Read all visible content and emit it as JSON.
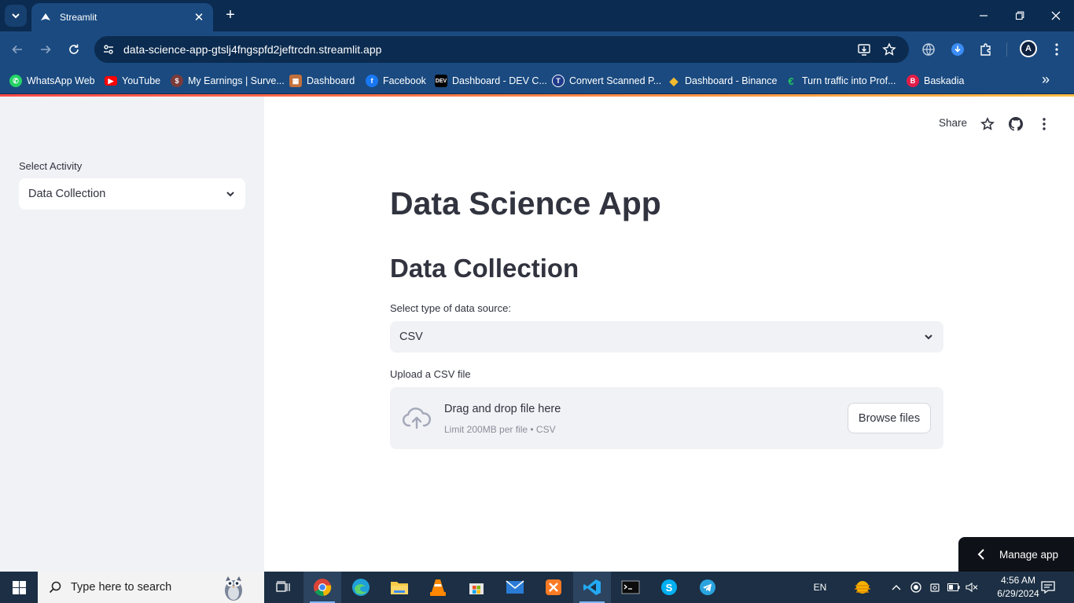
{
  "browser": {
    "tab_title": "Streamlit",
    "url": "data-science-app-gtslj4fngspfd2jeftrcdn.streamlit.app",
    "profile_initial": "A",
    "bookmarks": [
      {
        "label": "WhatsApp Web",
        "icon": "whatsapp-icon",
        "color": "#25d366"
      },
      {
        "label": "YouTube",
        "icon": "youtube-icon",
        "color": "#ff0000"
      },
      {
        "label": "My Earnings | Surve...",
        "icon": "earnings-icon",
        "color": "#d9534f"
      },
      {
        "label": "Dashboard",
        "icon": "dashboard-icon",
        "color": "#f0ad4e"
      },
      {
        "label": "Facebook",
        "icon": "facebook-icon",
        "color": "#1877f2"
      },
      {
        "label": "Dashboard - DEV C...",
        "icon": "dev-icon",
        "color": "#000000"
      },
      {
        "label": "Convert Scanned P...",
        "icon": "convert-icon",
        "color": "#1e3a8a"
      },
      {
        "label": "Dashboard - Binance",
        "icon": "binance-icon",
        "color": "#f3ba2f"
      },
      {
        "label": "Turn traffic into Prof...",
        "icon": "traffic-icon",
        "color": "#22c55e"
      },
      {
        "label": "Baskadia",
        "icon": "baskadia-icon",
        "color": "#e11d48"
      }
    ]
  },
  "sidebar": {
    "label": "Select Activity",
    "selected": "Data Collection"
  },
  "header": {
    "share_label": "Share"
  },
  "main": {
    "title": "Data Science App",
    "subtitle": "Data Collection",
    "source_label": "Select type of data source:",
    "source_selected": "CSV",
    "upload_label": "Upload a CSV file",
    "drag_text": "Drag and drop file here",
    "limit_text": "Limit 200MB per file • CSV",
    "browse_label": "Browse files"
  },
  "manage_app_label": "Manage app",
  "taskbar": {
    "search_placeholder": "Type here to search",
    "language": "EN",
    "time": "4:56 AM",
    "date": "6/29/2024"
  },
  "colors": {
    "chrome_dark": "#0b2b50",
    "chrome": "#1a4a80",
    "sidebar_bg": "#f0f2f6",
    "text": "#31333f",
    "accent_red": "#ff4b4b"
  }
}
